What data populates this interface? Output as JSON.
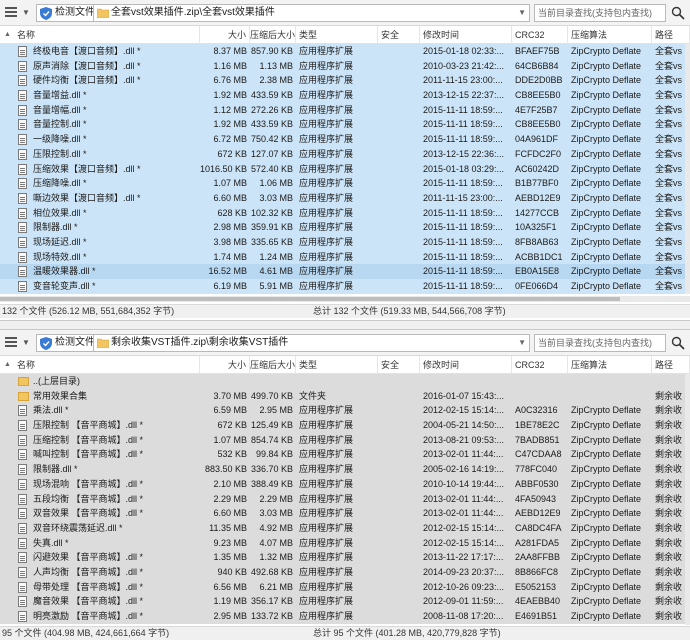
{
  "pane1": {
    "check_label": "检测文件",
    "path": "全套vst效果插件.zip\\全套vst效果插件",
    "search_placeholder": "当前目录查找(支持包内查找)",
    "columns": {
      "name": "名称",
      "size": "大小",
      "packed": "压缩后大小",
      "type": "类型",
      "security": "安全",
      "modified": "修改时间",
      "crc": "CRC32",
      "method": "压缩算法",
      "path": "路径"
    },
    "rows": [
      {
        "name": "终极电音【渡口音频】.dll *",
        "size": "8.37 MB",
        "packed": "857.90 KB",
        "type": "应用程序扩展",
        "modified": "2015-01-18 02:33:...",
        "crc": "BFAEF75B",
        "method": "ZipCrypto Deflate",
        "path": "全套vs",
        "state": "sel"
      },
      {
        "name": "原声消除【渡口音频】.dll *",
        "size": "1.16 MB",
        "packed": "1.13 MB",
        "type": "应用程序扩展",
        "modified": "2010-03-23 21:42:...",
        "crc": "64CB6B84",
        "method": "ZipCrypto Deflate",
        "path": "全套vs",
        "state": "sel"
      },
      {
        "name": "硬件均衡【渡口音频】.dll *",
        "size": "6.76 MB",
        "packed": "2.38 MB",
        "type": "应用程序扩展",
        "modified": "2011-11-15 23:00:...",
        "crc": "DDE2D0BB",
        "method": "ZipCrypto Deflate",
        "path": "全套vs",
        "state": "sel"
      },
      {
        "name": "音量增益.dll *",
        "size": "1.92 MB",
        "packed": "433.59 KB",
        "type": "应用程序扩展",
        "modified": "2013-12-15 22:37:...",
        "crc": "CB8EE5B0",
        "method": "ZipCrypto Deflate",
        "path": "全套vs",
        "state": "sel"
      },
      {
        "name": "音量增幅.dll *",
        "size": "1.12 MB",
        "packed": "272.26 KB",
        "type": "应用程序扩展",
        "modified": "2015-11-11 18:59:...",
        "crc": "4E7F25B7",
        "method": "ZipCrypto Deflate",
        "path": "全套vs",
        "state": "sel"
      },
      {
        "name": "音量控制.dll *",
        "size": "1.92 MB",
        "packed": "433.59 KB",
        "type": "应用程序扩展",
        "modified": "2015-11-11 18:59:...",
        "crc": "CB8EE5B0",
        "method": "ZipCrypto Deflate",
        "path": "全套vs",
        "state": "sel"
      },
      {
        "name": "一级降噪.dll *",
        "size": "6.72 MB",
        "packed": "750.42 KB",
        "type": "应用程序扩展",
        "modified": "2015-11-11 18:59:...",
        "crc": "04A961DF",
        "method": "ZipCrypto Deflate",
        "path": "全套vs",
        "state": "sel"
      },
      {
        "name": "压限控制.dll *",
        "size": "672 KB",
        "packed": "127.07 KB",
        "type": "应用程序扩展",
        "modified": "2013-12-15 22:36:...",
        "crc": "FCFDC2F0",
        "method": "ZipCrypto Deflate",
        "path": "全套vs",
        "state": "sel"
      },
      {
        "name": "压缩效果【渡口音频】.dll *",
        "size": "1016.50 KB",
        "packed": "572.40 KB",
        "type": "应用程序扩展",
        "modified": "2015-01-18 03:29:...",
        "crc": "AC60242D",
        "method": "ZipCrypto Deflate",
        "path": "全套vs",
        "state": "sel"
      },
      {
        "name": "压缩降噪.dll *",
        "size": "1.07 MB",
        "packed": "1.06 MB",
        "type": "应用程序扩展",
        "modified": "2015-11-11 18:59:...",
        "crc": "B1B77BF0",
        "method": "ZipCrypto Deflate",
        "path": "全套vs",
        "state": "sel"
      },
      {
        "name": "嘶边效果【渡口音频】.dll *",
        "size": "6.60 MB",
        "packed": "3.03 MB",
        "type": "应用程序扩展",
        "modified": "2011-11-15 23:00:...",
        "crc": "AEBD12E9",
        "method": "ZipCrypto Deflate",
        "path": "全套vs",
        "state": "sel"
      },
      {
        "name": "相位效果.dll *",
        "size": "628 KB",
        "packed": "102.32 KB",
        "type": "应用程序扩展",
        "modified": "2015-11-11 18:59:...",
        "crc": "14277CCB",
        "method": "ZipCrypto Deflate",
        "path": "全套vs",
        "state": "sel"
      },
      {
        "name": "限制器.dll *",
        "size": "2.98 MB",
        "packed": "359.91 KB",
        "type": "应用程序扩展",
        "modified": "2015-11-11 18:59:...",
        "crc": "10A325F1",
        "method": "ZipCrypto Deflate",
        "path": "全套vs",
        "state": "sel"
      },
      {
        "name": "现场延迟.dll *",
        "size": "3.98 MB",
        "packed": "335.65 KB",
        "type": "应用程序扩展",
        "modified": "2015-11-11 18:59:...",
        "crc": "8FB8AB63",
        "method": "ZipCrypto Deflate",
        "path": "全套vs",
        "state": "sel"
      },
      {
        "name": "现场特效.dll *",
        "size": "1.74 MB",
        "packed": "1.24 MB",
        "type": "应用程序扩展",
        "modified": "2015-11-11 18:59:...",
        "crc": "ACBB1DC1",
        "method": "ZipCrypto Deflate",
        "path": "全套vs",
        "state": "sel"
      },
      {
        "name": "温暖效果器.dll *",
        "size": "16.52 MB",
        "packed": "4.61 MB",
        "type": "应用程序扩展",
        "modified": "2015-11-11 18:59:...",
        "crc": "EB0A15E8",
        "method": "ZipCrypto Deflate",
        "path": "全套vs",
        "state": "hl"
      },
      {
        "name": "变音轮变声.dll *",
        "size": "6.19 MB",
        "packed": "5.91 MB",
        "type": "应用程序扩展",
        "modified": "2015-11-11 18:59:...",
        "crc": "0FE066D4",
        "method": "ZipCrypto Deflate",
        "path": "全套vs",
        "state": "sel"
      }
    ],
    "status_left": "132 个文件 (526.12 MB, 551,684,352 字节)",
    "status_mid": "总计 132 个文件 (519.33 MB, 544,566,708 字节)"
  },
  "pane2": {
    "check_label": "检测文件",
    "path": "剩余收集VST插件.zip\\剩余收集VST插件",
    "search_placeholder": "当前目录查找(支持包内查找)",
    "columns": {
      "name": "名称",
      "size": "大小",
      "packed": "压缩后大小",
      "type": "类型",
      "security": "安全",
      "modified": "修改时间",
      "crc": "CRC32",
      "method": "压缩算法",
      "path": "路径"
    },
    "rows": [
      {
        "name": "..(上层目录)",
        "size": "",
        "packed": "",
        "type": "",
        "modified": "",
        "crc": "",
        "method": "",
        "path": "",
        "state": "grey",
        "icon": "folder"
      },
      {
        "name": "常用效果合集",
        "size": "3.70 MB",
        "packed": "499.70 KB",
        "type": "文件夹",
        "modified": "2016-01-07 15:43:...",
        "crc": "",
        "method": "",
        "path": "剩余收",
        "state": "grey",
        "icon": "folder"
      },
      {
        "name": "乘法.dll *",
        "size": "6.59 MB",
        "packed": "2.95 MB",
        "type": "应用程序扩展",
        "modified": "2012-02-15 15:14:...",
        "crc": "A0C32316",
        "method": "ZipCrypto Deflate",
        "path": "剩余收",
        "state": "grey",
        "icon": "file"
      },
      {
        "name": "压限控制    【音平商城】.dll *",
        "size": "672 KB",
        "packed": "125.49 KB",
        "type": "应用程序扩展",
        "modified": "2004-05-21 14:50:...",
        "crc": "1BE78E2C",
        "method": "ZipCrypto Deflate",
        "path": "剩余收",
        "state": "grey",
        "icon": "file"
      },
      {
        "name": "压缩控制    【音平商城】.dll *",
        "size": "1.07 MB",
        "packed": "854.74 KB",
        "type": "应用程序扩展",
        "modified": "2013-08-21 09:53:...",
        "crc": "7BADB851",
        "method": "ZipCrypto Deflate",
        "path": "剩余收",
        "state": "grey",
        "icon": "file"
      },
      {
        "name": "喊叫控制    【音平商城】.dll *",
        "size": "532 KB",
        "packed": "99.84 KB",
        "type": "应用程序扩展",
        "modified": "2013-02-01 11:44:...",
        "crc": "C47CDAA8",
        "method": "ZipCrypto Deflate",
        "path": "剩余收",
        "state": "grey",
        "icon": "file"
      },
      {
        "name": "限制器.dll *",
        "size": "883.50 KB",
        "packed": "336.70 KB",
        "type": "应用程序扩展",
        "modified": "2005-02-16 14:19:...",
        "crc": "778FC040",
        "method": "ZipCrypto Deflate",
        "path": "剩余收",
        "state": "grey",
        "icon": "file"
      },
      {
        "name": "现场混响    【音平商城】.dll *",
        "size": "2.10 MB",
        "packed": "388.49 KB",
        "type": "应用程序扩展",
        "modified": "2010-10-14 19:44:...",
        "crc": "ABBF0530",
        "method": "ZipCrypto Deflate",
        "path": "剩余收",
        "state": "grey",
        "icon": "file"
      },
      {
        "name": "五段均衡    【音平商城】.dll *",
        "size": "2.29 MB",
        "packed": "2.29 MB",
        "type": "应用程序扩展",
        "modified": "2013-02-01 11:44:...",
        "crc": "4FA50943",
        "method": "ZipCrypto Deflate",
        "path": "剩余收",
        "state": "grey",
        "icon": "file"
      },
      {
        "name": "双音效果    【音平商城】.dll *",
        "size": "6.60 MB",
        "packed": "3.03 MB",
        "type": "应用程序扩展",
        "modified": "2013-02-01 11:44:...",
        "crc": "AEBD12E9",
        "method": "ZipCrypto Deflate",
        "path": "剩余收",
        "state": "grey",
        "icon": "file"
      },
      {
        "name": "双音环绕震荡延迟.dll *",
        "size": "11.35 MB",
        "packed": "4.92 MB",
        "type": "应用程序扩展",
        "modified": "2012-02-15 15:14:...",
        "crc": "CA8DC4FA",
        "method": "ZipCrypto Deflate",
        "path": "剩余收",
        "state": "grey",
        "icon": "file"
      },
      {
        "name": "失真.dll *",
        "size": "9.23 MB",
        "packed": "4.07 MB",
        "type": "应用程序扩展",
        "modified": "2012-02-15 15:14:...",
        "crc": "A281FDA5",
        "method": "ZipCrypto Deflate",
        "path": "剩余收",
        "state": "grey",
        "icon": "file"
      },
      {
        "name": "闪避效果    【音平商城】.dll *",
        "size": "1.35 MB",
        "packed": "1.32 MB",
        "type": "应用程序扩展",
        "modified": "2013-11-22 17:17:...",
        "crc": "2AA8FFBB",
        "method": "ZipCrypto Deflate",
        "path": "剩余收",
        "state": "grey",
        "icon": "file"
      },
      {
        "name": "人声均衡    【音平商城】.dll *",
        "size": "940 KB",
        "packed": "492.68 KB",
        "type": "应用程序扩展",
        "modified": "2014-09-23 20:37:...",
        "crc": "8B866FC8",
        "method": "ZipCrypto Deflate",
        "path": "剩余收",
        "state": "grey",
        "icon": "file"
      },
      {
        "name": "母带处理    【音平商城】.dll *",
        "size": "6.56 MB",
        "packed": "6.21 MB",
        "type": "应用程序扩展",
        "modified": "2012-10-26 09:23:...",
        "crc": "E5052153",
        "method": "ZipCrypto Deflate",
        "path": "剩余收",
        "state": "grey",
        "icon": "file"
      },
      {
        "name": "魔音效果    【音平商城】.dll *",
        "size": "1.19 MB",
        "packed": "356.17 KB",
        "type": "应用程序扩展",
        "modified": "2012-09-01 11:59:...",
        "crc": "4EAEBB40",
        "method": "ZipCrypto Deflate",
        "path": "剩余收",
        "state": "grey",
        "icon": "file"
      },
      {
        "name": "明亮激励    【音平商城】.dll *",
        "size": "2.95 MB",
        "packed": "133.72 KB",
        "type": "应用程序扩展",
        "modified": "2008-11-08 17:20:...",
        "crc": "E4691B51",
        "method": "ZipCrypto Deflate",
        "path": "剩余收",
        "state": "grey",
        "icon": "file"
      }
    ],
    "status_left": "95 个文件 (404.98 MB, 424,661,664 字节)",
    "status_mid": "总计 95 个文件 (401.28 MB, 420,779,828 字节)"
  },
  "colors": {
    "selected": "#cce4f7",
    "highlight": "#b8d8f2",
    "grey_row": "#dcdcdc",
    "toolbar": "#f3f3f3",
    "folder": "#f3c560"
  }
}
